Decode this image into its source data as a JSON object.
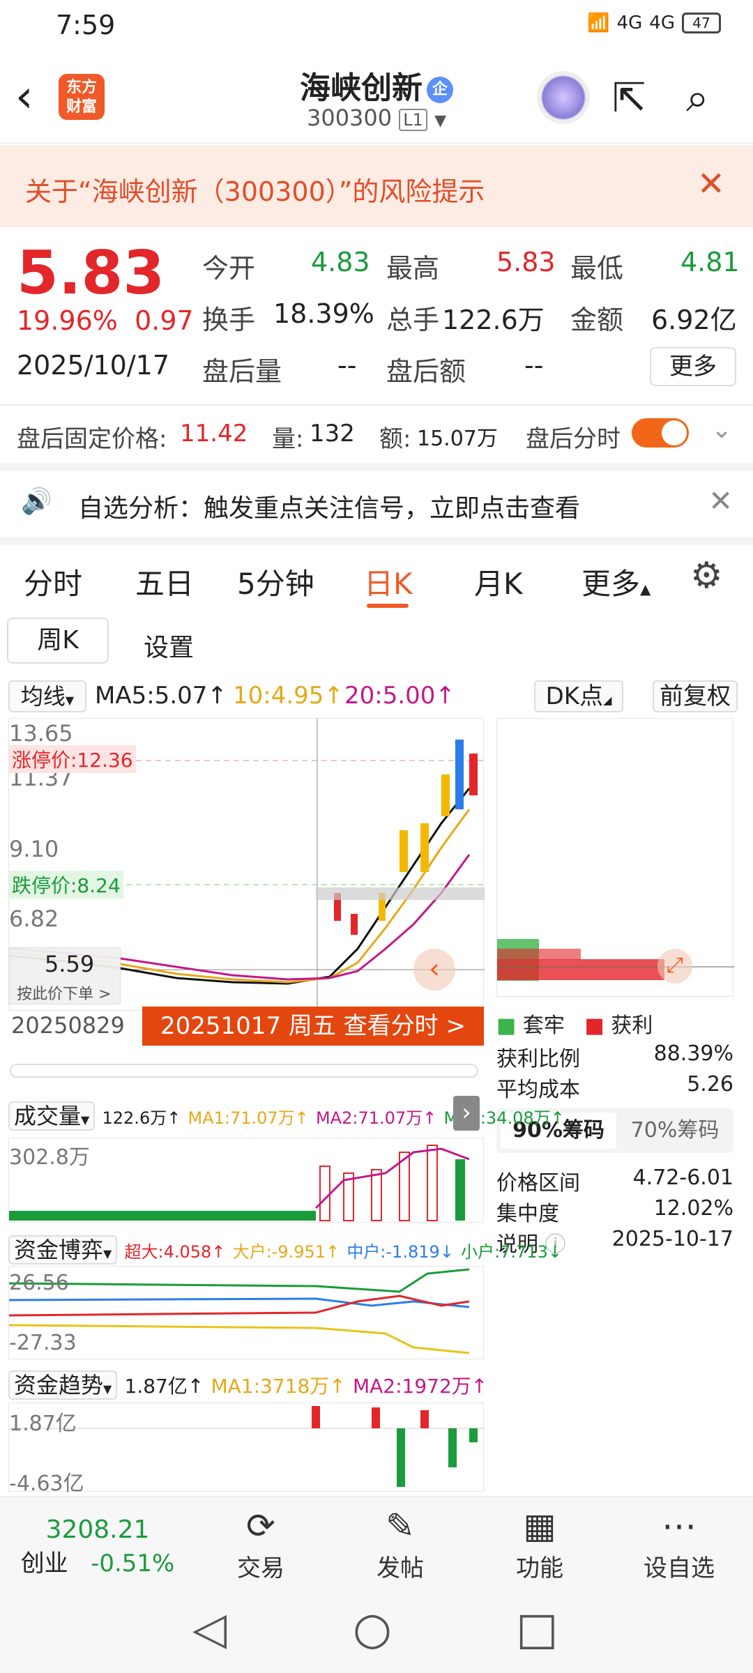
{
  "status": {
    "time": "7:59",
    "net1": "4G",
    "net2": "4G",
    "battery": "47"
  },
  "header": {
    "logo": "东方\n财富",
    "title": "海峡创新",
    "badge": "企",
    "code": "300300",
    "level": "L1"
  },
  "warning": {
    "text": "关于“海峡创新（300300）”的风险提示"
  },
  "quote": {
    "price": "5.83",
    "change_pct": "19.96%",
    "change": "0.97",
    "date": "2025/10/17",
    "open_label": "今开",
    "open": "4.83",
    "high_label": "最高",
    "high": "5.83",
    "low_label": "最低",
    "low": "4.81",
    "turnover_label": "换手",
    "turnover": "18.39%",
    "volume_label": "总手",
    "volume": "122.6万",
    "amount_label": "金额",
    "amount": "6.92亿",
    "after_vol_label": "盘后量",
    "after_vol": "--",
    "after_amt_label": "盘后额",
    "after_amt": "--",
    "more": "更多"
  },
  "after_hours": {
    "fixed_label": "盘后固定价格:",
    "fixed_price": "11.42",
    "vol_label": "量:",
    "vol": "132",
    "amt_label": "额:",
    "amt": "15.07万",
    "toggle_label": "盘后分时"
  },
  "analysis": {
    "text": "自选分析：触发重点关注信号，立即点击查看"
  },
  "tabs": [
    "分时",
    "五日",
    "5分钟",
    "日K",
    "月K",
    "更多"
  ],
  "subtabs": [
    "周K",
    "设置"
  ],
  "ma": {
    "label": "均线",
    "ma5": "MA5:5.07↑",
    "ma10": "10:4.95↑",
    "ma20": "20:5.00↑",
    "dk": "DK点",
    "fq": "前复权"
  },
  "kchart": {
    "y_labels": [
      "13.65",
      "11.37",
      "9.10",
      "6.82"
    ],
    "limit_up": "涨停价:12.36",
    "limit_down": "跌停价:8.24",
    "cursor_price": "5.59",
    "cursor_hint": "按此价下单 >",
    "start_date": "20250829",
    "banner": "20251017 周五 查看分时 >"
  },
  "chips": {
    "legend_loss": "套牢",
    "legend_profit": "获利",
    "profit_ratio_label": "获利比例",
    "profit_ratio": "88.39%",
    "avg_cost_label": "平均成本",
    "avg_cost": "5.26",
    "tab90": "90%筹码",
    "tab70": "70%筹码",
    "range_label": "价格区间",
    "range": "4.72-6.01",
    "conc_label": "集中度",
    "conc": "12.02%",
    "note_label": "说明",
    "note": "2025-10-17"
  },
  "volume": {
    "label": "成交量",
    "vol": "122.6万↑",
    "ma1": "MA1:71.07万↑",
    "ma2": "MA2:71.07万↑",
    "ma3": "MA3:34.08万↑",
    "max": "302.8万"
  },
  "fund": {
    "label": "资金博弈",
    "super": "超大:4.058↑",
    "big": "大户:-9.951↑",
    "mid": "中户:-1.819↓",
    "small": "小户:7.713↓",
    "top": "26.56",
    "bottom": "-27.33"
  },
  "trend": {
    "label": "资金趋势",
    "val": "1.87亿↑",
    "ma1": "MA1:3718万↑",
    "ma2": "MA2:1972万↑",
    "top": "1.87亿",
    "bottom": "-4.63亿"
  },
  "bottom": {
    "index_val": "3208.21",
    "index_name": "创业",
    "index_chg": "-0.51%",
    "trade": "交易",
    "post": "发帖",
    "func": "功能",
    "watch": "设自选"
  },
  "colors": {
    "up": "#e3262a",
    "down": "#1a9b3c",
    "accent": "#f05a28"
  }
}
